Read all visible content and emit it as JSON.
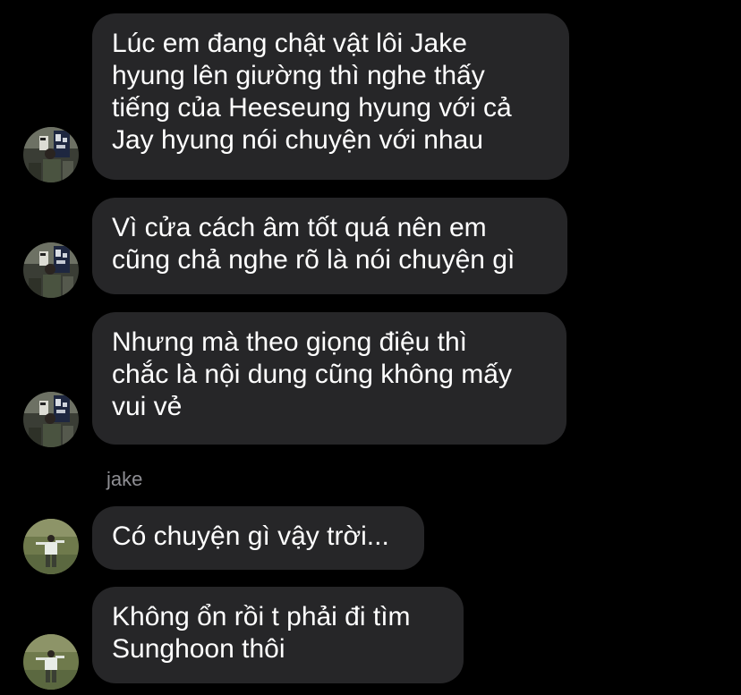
{
  "messages": [
    {
      "sender": "",
      "avatar": "sunoo-avatar-icon",
      "lines": [
        "Lúc em đang chật vật lôi Jake",
        "hyung lên giường thì nghe thấy",
        "tiếng của Heeseung hyung với cả",
        "Jay hyung nói chuyện với nhau"
      ]
    },
    {
      "sender": "",
      "avatar": "sunoo-avatar-icon",
      "lines": [
        "Vì cửa cách âm tốt quá nên em",
        "cũng chả nghe rõ là nói chuyện gì"
      ]
    },
    {
      "sender": "",
      "avatar": "sunoo-avatar-icon",
      "lines": [
        "Nhưng mà theo giọng điệu thì",
        "chắc là nội dung cũng không mấy",
        "vui vẻ"
      ]
    },
    {
      "sender": "jake",
      "avatar": "jake-avatar-icon",
      "lines": [
        "Có chuyện gì vậy trời..."
      ]
    },
    {
      "sender": "",
      "avatar": "jake-avatar-icon",
      "lines": [
        "Không ổn rồi t phải đi tìm",
        "Sunghoon thôi"
      ]
    }
  ],
  "colors": {
    "background": "#000000",
    "bubble": "#262628",
    "text": "#ffffff",
    "sender_name": "#8e8e93"
  }
}
